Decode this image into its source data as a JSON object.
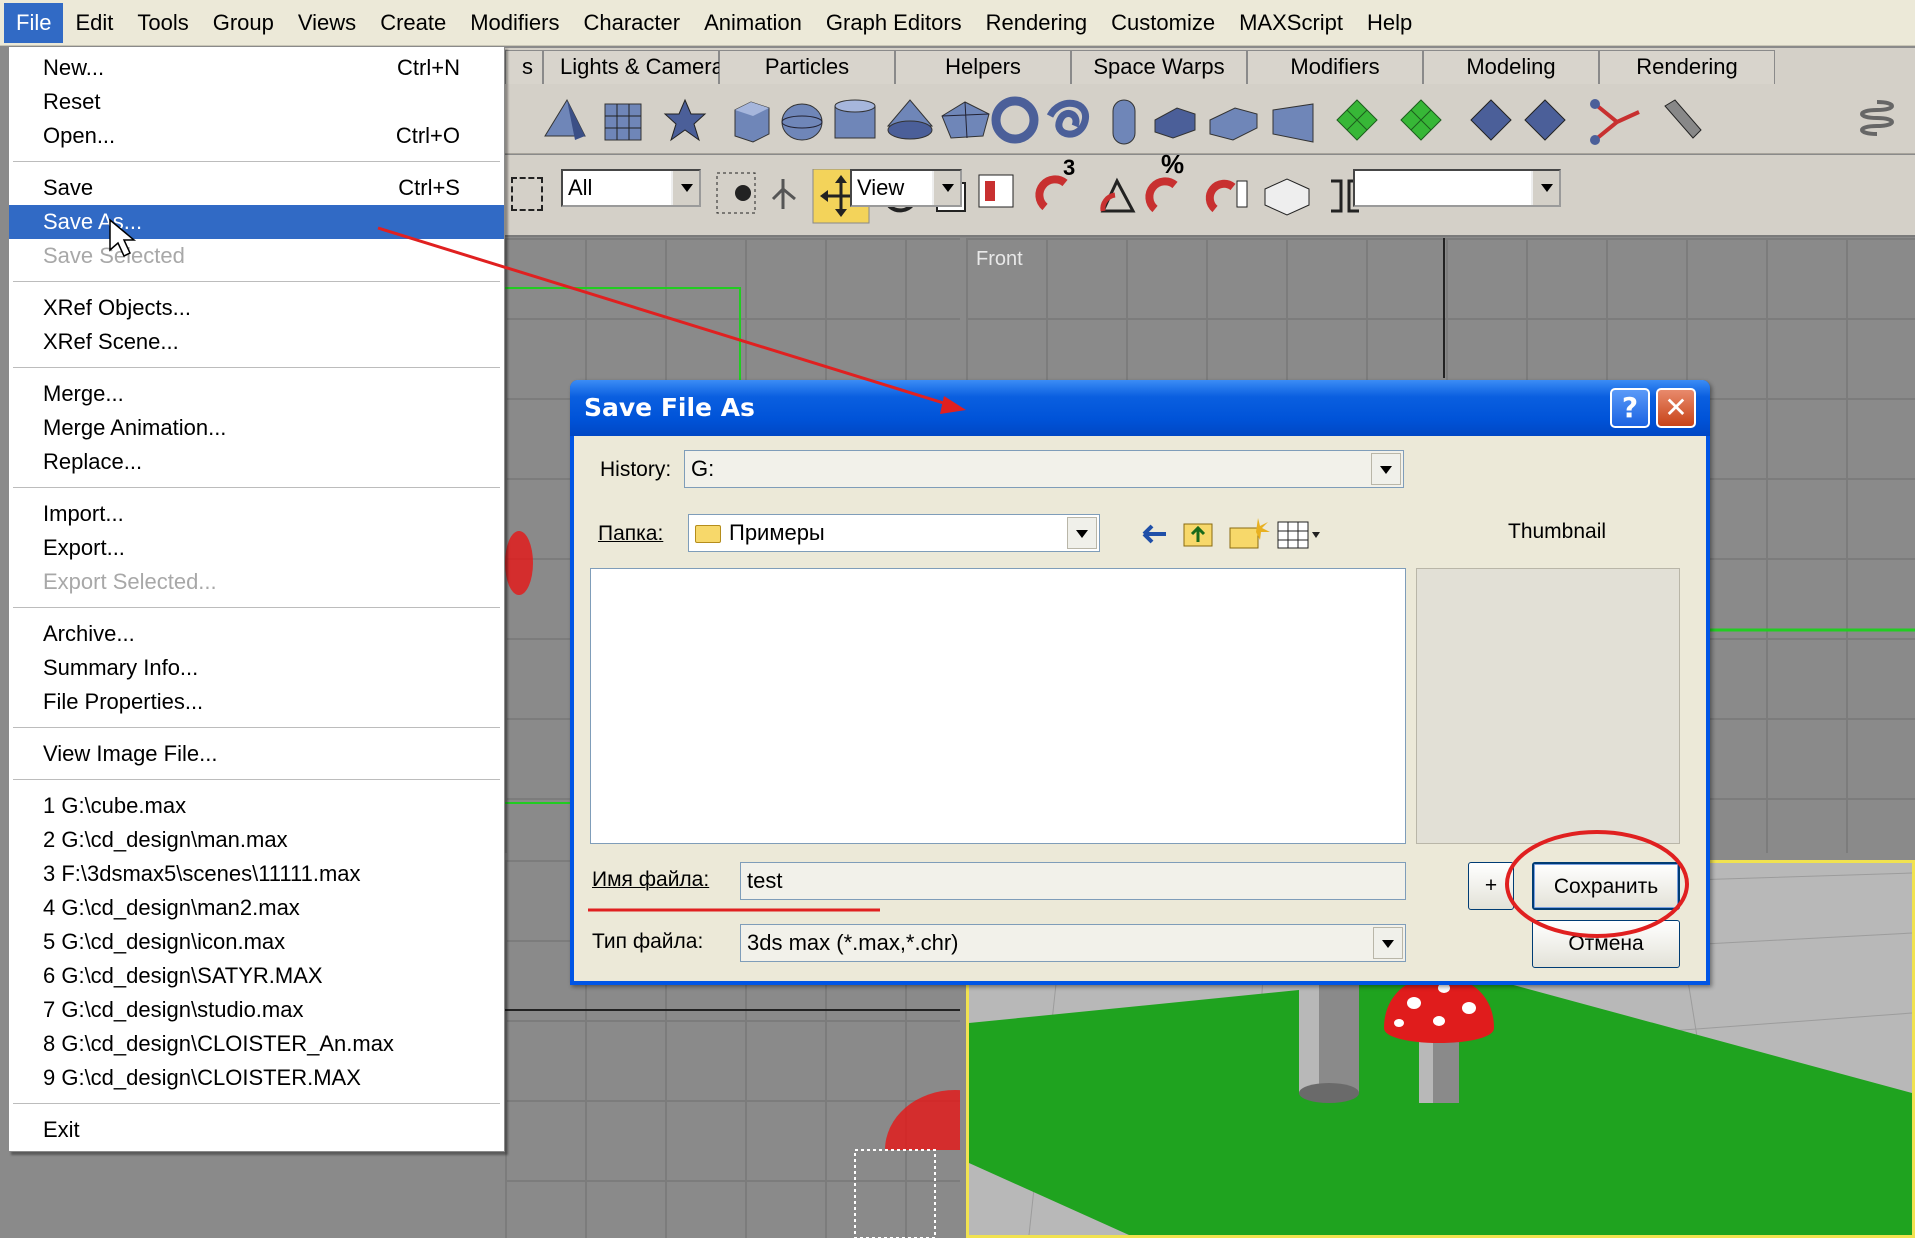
{
  "menubar": {
    "items": [
      "File",
      "Edit",
      "Tools",
      "Group",
      "Views",
      "Create",
      "Modifiers",
      "Character",
      "Animation",
      "Graph Editors",
      "Rendering",
      "Customize",
      "MAXScript",
      "Help"
    ]
  },
  "tabs": [
    "s",
    "Lights & Cameras",
    "Particles",
    "Helpers",
    "Space Warps",
    "Modifiers",
    "Modeling",
    "Rendering"
  ],
  "toolbar": {
    "selection_filter": "All",
    "ref_coord": "View",
    "named_sets": "",
    "angle_snap_label": "3",
    "percent_label": "%"
  },
  "viewports": {
    "front_label": "Front"
  },
  "file_menu": {
    "groups": [
      [
        {
          "label": "New...",
          "shortcut": "Ctrl+N"
        },
        {
          "label": "Reset",
          "shortcut": ""
        },
        {
          "label": "Open...",
          "shortcut": "Ctrl+O"
        }
      ],
      [
        {
          "label": "Save",
          "shortcut": "Ctrl+S"
        },
        {
          "label": "Save As...",
          "shortcut": "",
          "selected": true
        },
        {
          "label": "Save Selected",
          "shortcut": "",
          "disabled": true
        }
      ],
      [
        {
          "label": "XRef Objects...",
          "shortcut": ""
        },
        {
          "label": "XRef Scene...",
          "shortcut": ""
        }
      ],
      [
        {
          "label": "Merge...",
          "shortcut": ""
        },
        {
          "label": "Merge Animation...",
          "shortcut": ""
        },
        {
          "label": "Replace...",
          "shortcut": ""
        }
      ],
      [
        {
          "label": "Import...",
          "shortcut": ""
        },
        {
          "label": "Export...",
          "shortcut": ""
        },
        {
          "label": "Export Selected...",
          "shortcut": "",
          "disabled": true
        }
      ],
      [
        {
          "label": "Archive...",
          "shortcut": ""
        },
        {
          "label": "Summary Info...",
          "shortcut": ""
        },
        {
          "label": "File Properties...",
          "shortcut": ""
        }
      ],
      [
        {
          "label": "View Image File...",
          "shortcut": ""
        }
      ],
      [
        {
          "label": "1 G:\\cube.max",
          "shortcut": ""
        },
        {
          "label": "2 G:\\cd_design\\man.max",
          "shortcut": ""
        },
        {
          "label": "3 F:\\3dsmax5\\scenes\\11111.max",
          "shortcut": ""
        },
        {
          "label": "4 G:\\cd_design\\man2.max",
          "shortcut": ""
        },
        {
          "label": "5 G:\\cd_design\\icon.max",
          "shortcut": ""
        },
        {
          "label": "6 G:\\cd_design\\SATYR.MAX",
          "shortcut": ""
        },
        {
          "label": "7 G:\\cd_design\\studio.max",
          "shortcut": ""
        },
        {
          "label": "8 G:\\cd_design\\CLOISTER_An.max",
          "shortcut": ""
        },
        {
          "label": "9 G:\\cd_design\\CLOISTER.MAX",
          "shortcut": ""
        }
      ],
      [
        {
          "label": "Exit",
          "shortcut": ""
        }
      ]
    ]
  },
  "dialog": {
    "title": "Save File As",
    "help_glyph": "?",
    "close_glyph": "✕",
    "history_label": "History:",
    "history_value": "G:",
    "folder_label": "Папка:",
    "folder_value": "Примеры",
    "thumbnail_label": "Thumbnail",
    "filename_label": "Имя файла:",
    "filename_value": "test",
    "filetype_label": "Тип файла:",
    "filetype_value": "3ds max (*.max,*.chr)",
    "plus_label": "+",
    "save_button": "Сохранить",
    "cancel_button": "Отмена"
  },
  "colors": {
    "menu_highlight": "#316ac5",
    "dialog_title": "#0053d8",
    "annotation": "#e02020",
    "viewport_active_border": "#f1e250",
    "ground": "#1fa31f",
    "mushroom_cap": "#e01c1c"
  }
}
